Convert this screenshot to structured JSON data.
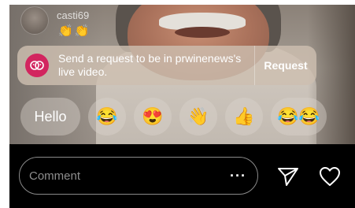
{
  "live_comment": {
    "username": "casti69",
    "emojis": "👏👏"
  },
  "request_banner": {
    "message": "Send a request to be in prwinenews's live video.",
    "button_label": "Request"
  },
  "reactions": {
    "hello_label": "Hello",
    "emojis": [
      "😂",
      "😍",
      "👋",
      "👍",
      "😂😂"
    ]
  },
  "comment_bar": {
    "placeholder": "Comment",
    "more_icon": "···"
  },
  "icons": {
    "send": "send-icon",
    "like": "heart-icon",
    "request": "face-request-icon"
  },
  "colors": {
    "request_icon_bg": "#d2255f",
    "background": "#000000"
  }
}
